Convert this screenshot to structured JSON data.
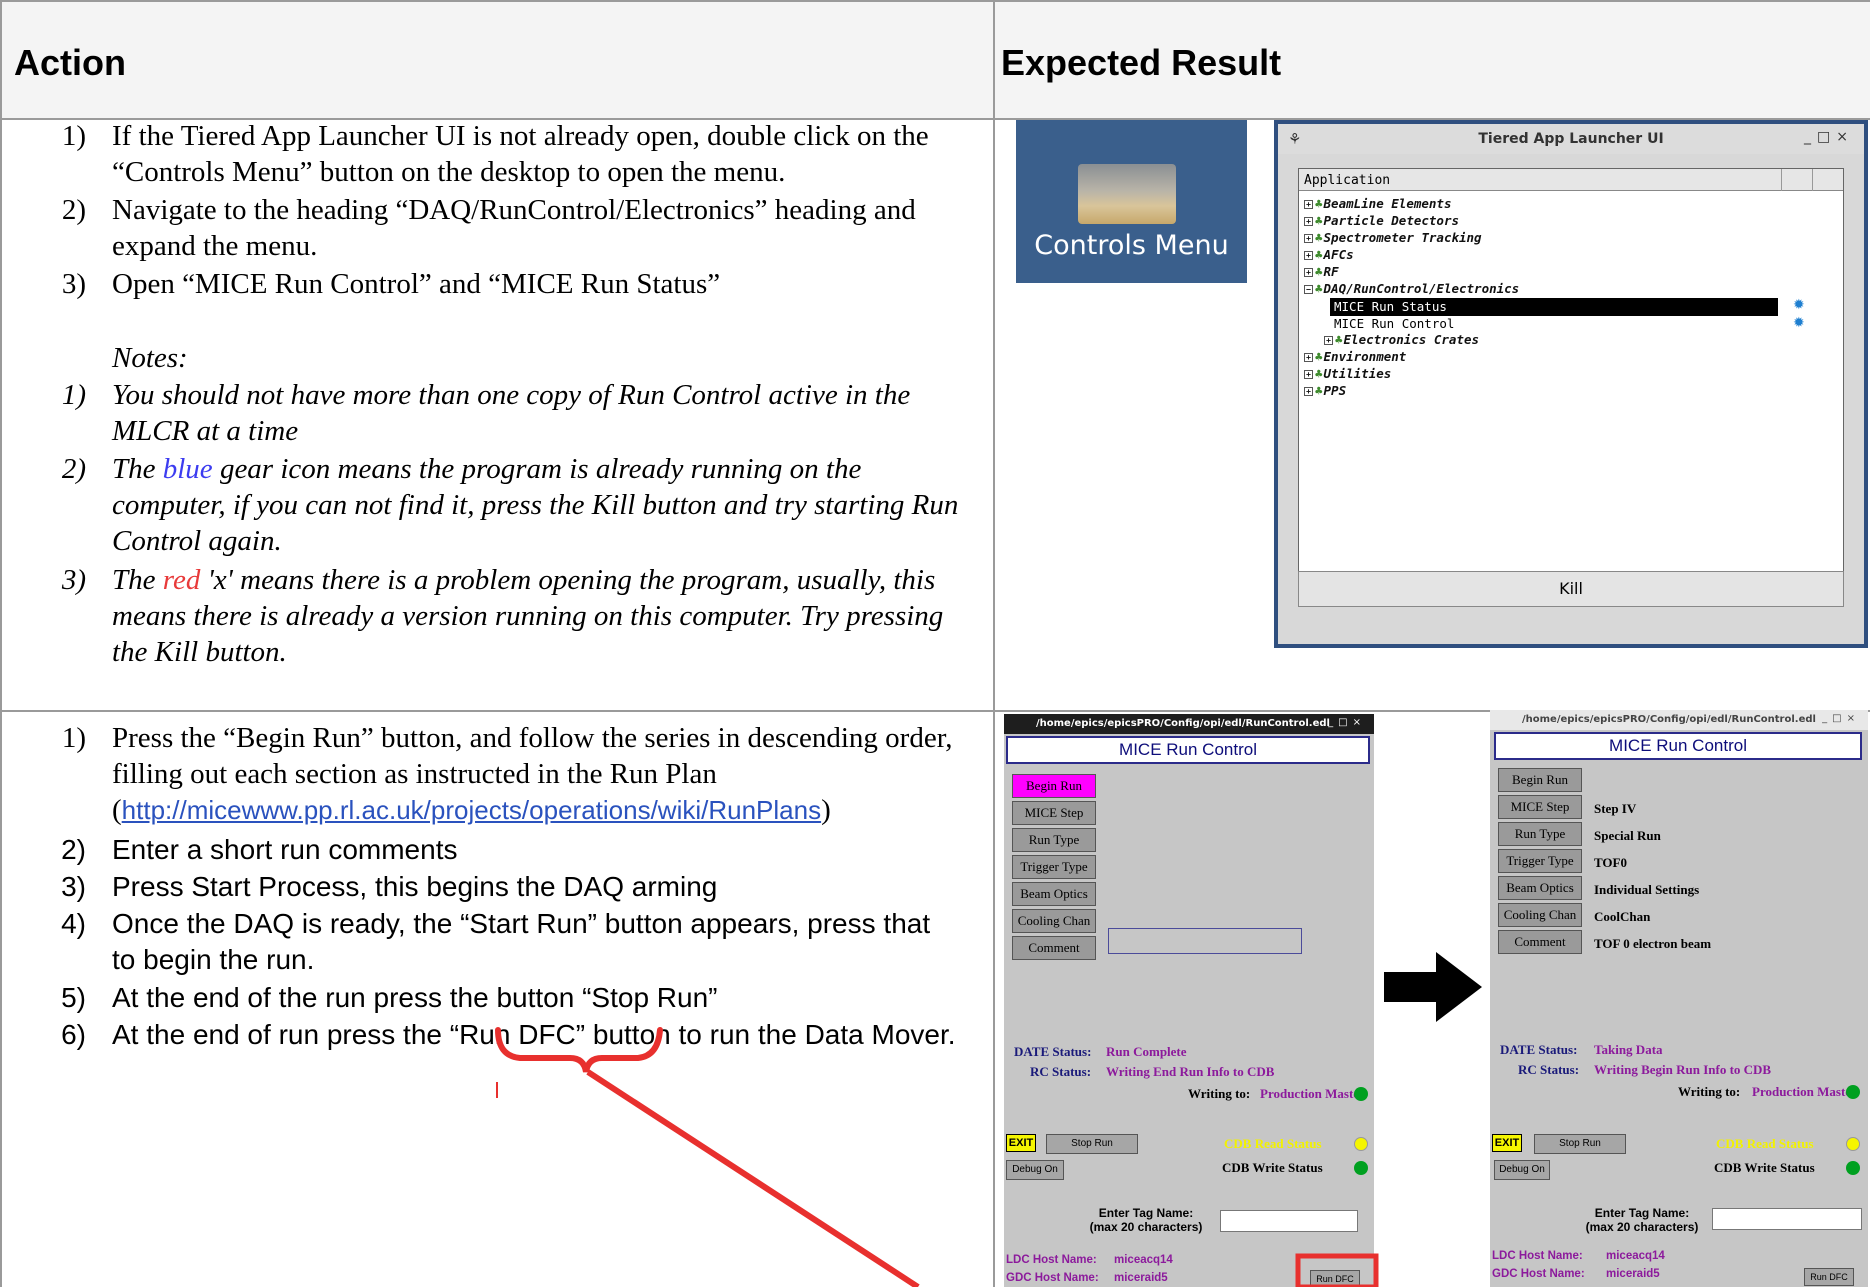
{
  "table": {
    "col_action": "Action",
    "col_expected": "Expected Result"
  },
  "row1": {
    "steps": [
      {
        "num": "1)",
        "text": "If the Tiered App Launcher UI is not already open, double click on the “Controls Menu” button on the desktop to open the menu."
      },
      {
        "num": "2)",
        "text": "Navigate to the heading “DAQ/RunControl/Electronics” heading and expand the menu."
      },
      {
        "num": "3)",
        "text": "Open “MICE Run Control” and “MICE Run Status”"
      }
    ],
    "notes_title": "Notes:",
    "notes": [
      {
        "num": "1)",
        "text": "You should not have more than one copy of Run Control active in the MLCR at a time"
      },
      {
        "num": "2)",
        "pre": "The ",
        "highlight": "blue",
        "post": " gear icon means the program is already running on the computer, if you can not find it, press the Kill button and try starting Run Control again."
      },
      {
        "num": "3)",
        "pre": "The ",
        "highlight": "red",
        "post": " 'x' means there is a problem opening the program, usually, this means there is already a version running on this computer. Try pressing the Kill button."
      }
    ],
    "desktop_icon_label": "Controls Menu",
    "launcher": {
      "title": "Tiered App Launcher UI",
      "column": "Application",
      "tree": [
        "BeamLine Elements",
        "Particle Detectors",
        "Spectrometer Tracking",
        "AFCs",
        "RF",
        "DAQ/RunControl/Electronics"
      ],
      "children": [
        "MICE Run Status",
        "MICE Run Control"
      ],
      "sub_group": "Electronics Crates",
      "tree_after": [
        "Environment",
        "Utilities",
        "PPS"
      ],
      "kill_label": "Kill"
    }
  },
  "row2": {
    "step1_pre": "Press the “Begin Run” button, and follow the series in descending order, filling out each section as instructed in the Run Plan",
    "step1_link": "http://micewww.pp.rl.ac.uk/projects/operations/wiki/RunPlans",
    "steps": [
      {
        "num": "2)",
        "text": "Enter a short run comments"
      },
      {
        "num": "3)",
        "text": "Press Start Process, this begins the DAQ arming"
      },
      {
        "num": "4)",
        "text": "Once the DAQ is ready, the “Start Run” button appears, press that to begin the run."
      },
      {
        "num": "5)",
        "text": "At the end of the run press the button “Stop Run”"
      },
      {
        "num": "6)",
        "text": "At the end of run press the “Run DFC” button to run the Data Mover."
      }
    ],
    "rc_path": "/home/epics/epicsPRO/Config/opi/edl/RunControl.edl",
    "rc_title": "MICE Run Control",
    "buttons": [
      "Begin Run",
      "MICE Step",
      "Run Type",
      "Trigger Type",
      "Beam Optics",
      "Cooling Chan",
      "Comment"
    ],
    "after_values": [
      "Step IV",
      "Special Run",
      "TOF0",
      "Individual Settings",
      "CoolChan",
      "TOF 0 electron beam"
    ],
    "date_status_label": "DATE Status:",
    "rc_status_label": "RC Status:",
    "before_date_status": "Run Complete",
    "before_rc_status": "Writing End Run Info to CDB",
    "after_date_status": "Taking Data",
    "after_rc_status": "Writing Begin Run Info to CDB",
    "writing_to_label": "Writing to:",
    "writing_to_value": "Production Master",
    "exit_label": "EXIT",
    "stop_run_label": "Stop Run",
    "debug_label": "Debug On",
    "cdb_read": "CDB Read Status",
    "cdb_write": "CDB Write Status",
    "tag_label_1": "Enter Tag Name:",
    "tag_label_2": "(max 20 characters)",
    "ldc_label": "LDC Host Name:",
    "ldc_value": "miceacq14",
    "gdc_label": "GDC Host Name:",
    "gdc_value": "miceraid5",
    "run_dfc": "Run DFC"
  },
  "colors": {
    "highlight_blue": "#3c3cf0",
    "highlight_red": "#e83a3a",
    "annotation_red": "#e8302e",
    "begin_run_active": "#ff00ff"
  }
}
